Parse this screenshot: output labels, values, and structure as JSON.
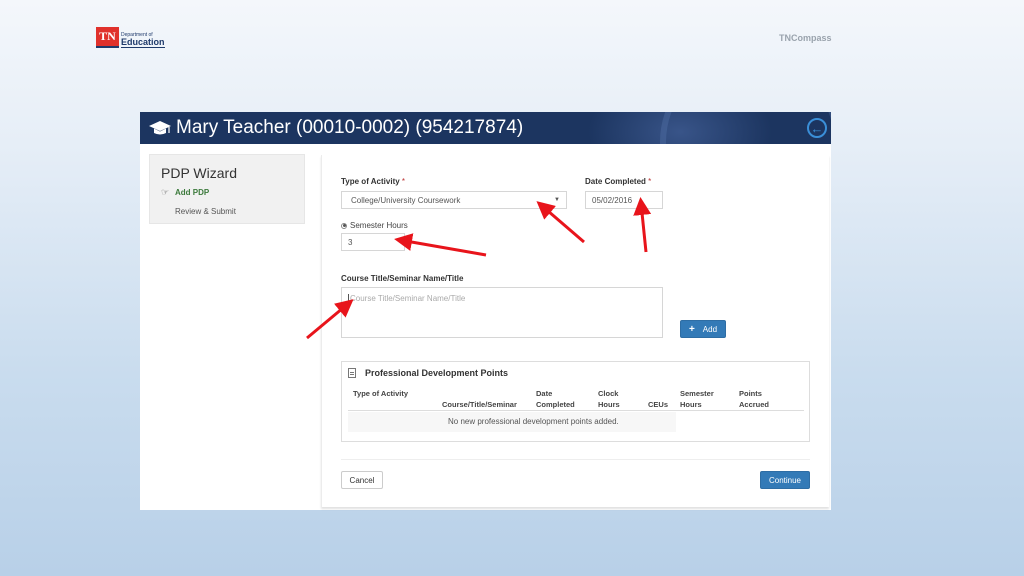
{
  "brand": {
    "logo_mark": "TN",
    "logo_small": "Department of",
    "logo_big": "Education",
    "app_name": "TNCompass"
  },
  "header": {
    "icon": "graduation-cap-icon",
    "title": "Mary Teacher (00010-0002) (954217874)",
    "back_icon": "circle-arrow-left-icon",
    "back_glyph": "←",
    "colors": {
      "bar": "#1c3560",
      "back": "#3a8fd8"
    }
  },
  "sidebar": {
    "title": "PDP Wizard",
    "items": [
      {
        "label": "Add PDP",
        "icon": "hand-pointing-icon",
        "icon_glyph": "☞",
        "active": true
      },
      {
        "label": "Review & Submit",
        "active": false
      }
    ]
  },
  "form": {
    "type_of_activity": {
      "label": "Type of Activity",
      "required_mark": "*",
      "value": "College/University Coursework",
      "caret": "▼"
    },
    "date_completed": {
      "label": "Date Completed",
      "required_mark": "*",
      "value": "05/02/2016"
    },
    "semester_hours": {
      "label": "Semester Hours",
      "value": "3",
      "selected": true
    },
    "course_title": {
      "label": "Course Title/Seminar Name/Title",
      "placeholder": "Course Title/Seminar Name/Title",
      "value": ""
    },
    "add_button": {
      "label": "Add",
      "icon_glyph": "+"
    }
  },
  "pdp_table": {
    "title": "Professional Development Points",
    "icon": "document-icon",
    "columns": [
      {
        "line1": "",
        "line2": "Type of Activity"
      },
      {
        "line1": "",
        "line2": "Course/Title/Seminar"
      },
      {
        "line1": "Date",
        "line2": "Completed"
      },
      {
        "line1": "Clock",
        "line2": "Hours"
      },
      {
        "line1": "",
        "line2": "CEUs"
      },
      {
        "line1": "Semester",
        "line2": "Hours"
      },
      {
        "line1": "Points",
        "line2": "Accrued"
      }
    ],
    "empty_message": "No new professional development points added."
  },
  "footer": {
    "cancel_label": "Cancel",
    "continue_label": "Continue",
    "primary_color": "#337ab7"
  },
  "annotations": {
    "arrow_color": "#e8141b",
    "count": 4
  }
}
